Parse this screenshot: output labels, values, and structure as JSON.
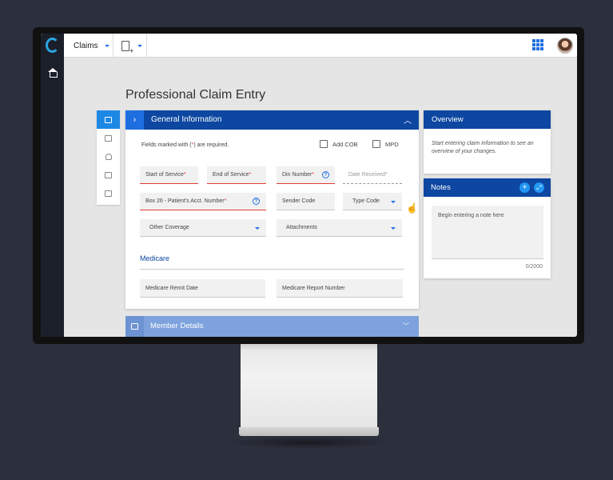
{
  "topbar": {
    "module": "Claims"
  },
  "page": {
    "title": "Professional Claim Entry"
  },
  "general": {
    "title": "General Information",
    "required_note_pre": "Fields marked with (",
    "required_note_star": "*",
    "required_note_post": ") are required.",
    "add_cob": "Add COB",
    "mpd": "MPD",
    "fields": {
      "start_of_service": "Start of Service",
      "end_of_service": "End of Service",
      "din_number": "Din Number",
      "date_received": "Date Received",
      "box26": "Box 26 - Patient's Acct. Number",
      "sender_code": "Sender Code",
      "type_code": "Type Code",
      "other_coverage": "Other Coverage",
      "attachments": "Attachments"
    },
    "required_star": "*",
    "medicare": {
      "heading": "Medicare",
      "remit_date": "Medicare Remit Date",
      "report_number": "Medicare Report Number"
    }
  },
  "member_details": {
    "title": "Member Details"
  },
  "overview": {
    "title": "Overview",
    "text": "Start entering claim information to see an overview of your changes."
  },
  "notes": {
    "title": "Notes",
    "placeholder": "Begin entering a note here",
    "counter": "0/2000",
    "add_symbol": "+",
    "expand_symbol": "⤢"
  },
  "icons": {
    "chevron_right": "›",
    "chevron_up": "︿",
    "chevron_down": "﹀",
    "help": "?",
    "hand_cursor": "☝"
  },
  "colors": {
    "primary": "#0d47a1",
    "accent": "#1e6ee0",
    "required": "#e53935",
    "sidebar": "#1b1f2a"
  }
}
